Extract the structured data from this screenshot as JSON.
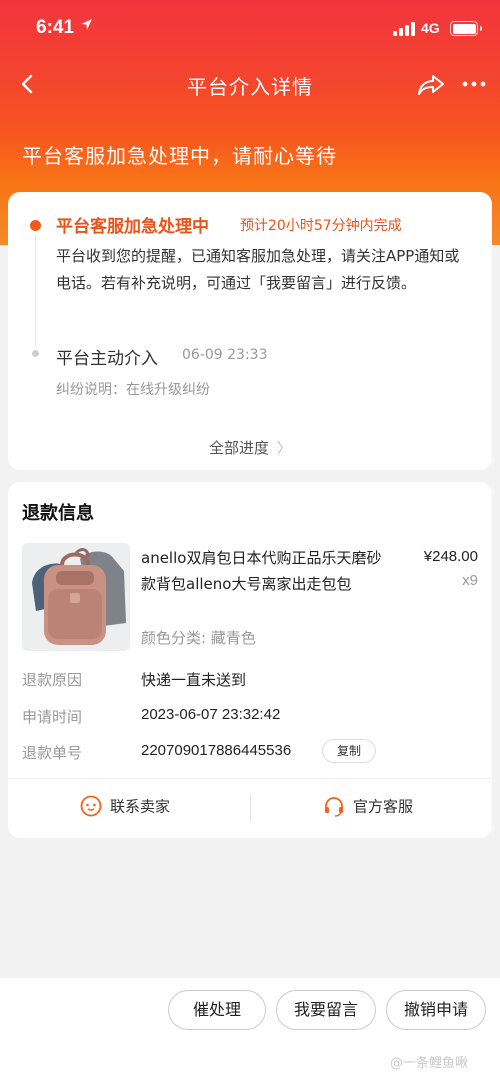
{
  "status_bar": {
    "time": "6:41",
    "network": "4G"
  },
  "nav": {
    "title": "平台介入详情"
  },
  "banner": {
    "text": "平台客服加急处理中，请耐心等待"
  },
  "progress": {
    "current": {
      "title": "平台客服加急处理中",
      "eta": "预计20小时57分钟内完成",
      "description": "平台收到您的提醒，已通知客服加急处理，请关注APP通知或电话。若有补充说明，可通过「我要留言」进行反馈。"
    },
    "previous": {
      "title": "平台主动介入",
      "time": "06-09 23:33",
      "description": "纠纷说明：在线升级纠纷"
    },
    "all_label": "全部进度"
  },
  "refund": {
    "section_title": "退款信息",
    "product": {
      "name": "anello双肩包日本代购正品乐天磨砂款背包alleno大号离家出走包包",
      "price": "¥248.00",
      "quantity": "x9",
      "sku": "颜色分类: 藏青色"
    },
    "rows": [
      {
        "label": "退款原因",
        "value": "快递一直未送到"
      },
      {
        "label": "申请时间",
        "value": "2023-06-07 23:32:42"
      },
      {
        "label": "退款单号",
        "value": "2207090178864455​36"
      }
    ],
    "copy_label": "复制",
    "contact_seller": "联系卖家",
    "official_service": "官方客服"
  },
  "bottom": {
    "urge": "催处理",
    "message": "我要留言",
    "cancel": "撤销申请",
    "watermark": "一条鲤鱼啾"
  },
  "colors": {
    "accent": "#e8541a",
    "header_top": "#f2343b",
    "header_bottom": "#f97516"
  }
}
